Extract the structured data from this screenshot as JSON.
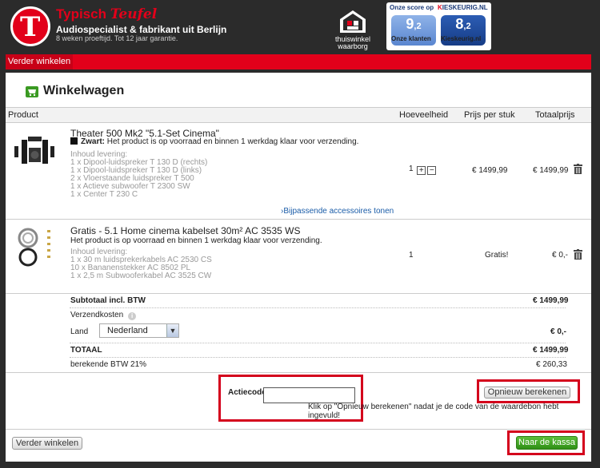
{
  "header": {
    "brand_name": "Typisch",
    "brand_script": "Teufel",
    "tagline": "Audiospecialist & fabrikant uit Berlijn",
    "subtagline": "8 weken proeftijd. Tot 12 jaar garantie.",
    "trust_badge": [
      "thuiswinkel",
      "waarborg"
    ],
    "score_title": "Onze score op",
    "score_brand_k": "K",
    "score_brand_rest": "IESKEURIG.NL",
    "scores": [
      {
        "value": "9",
        "decimal": ",2",
        "label": "Onze klanten"
      },
      {
        "value": "8",
        "decimal": ",2",
        "label": "Kieskeurig.nl"
      }
    ]
  },
  "nav": {
    "continue_shopping": "Verder winkelen"
  },
  "page_title": "Winkelwagen",
  "table": {
    "headers": {
      "product": "Product",
      "quantity": "Hoeveelheid",
      "unit_price": "Prijs per stuk",
      "total": "Totaalprijs"
    },
    "items": [
      {
        "title": "Theater 500 Mk2 \"5.1-Set Cinema\"",
        "color_label": "Zwart:",
        "stock": "Het product is op voorraad en binnen 1 werkdag klaar voor verzending.",
        "contents_label": "Inhoud levering:",
        "contents": [
          "1 x Dipool-luidspreker T 130 D (rechts)",
          "1 x Dipool-luidspreker T 130 D (links)",
          "2 x Vloerstaande luidspreker T 500",
          "1 x Actieve subwoofer T 2300 SW",
          "1 x Center T 230 C"
        ],
        "accessories": "Bijpassende accessoires tonen",
        "quantity": "1",
        "qty_plus": "+",
        "qty_minus": "−",
        "unit_price": "€ 1499,99",
        "total": "€ 1499,99"
      },
      {
        "title": "Gratis - 5.1 Home cinema kabelset 30m² AC 3535 WS",
        "stock": "Het product is op voorraad en binnen 1 werkdag klaar voor verzending.",
        "contents_label": "Inhoud levering:",
        "contents": [
          "1 x 30 m luidsprekerkabels AC 2530 CS",
          "10 x Bananenstekker AC 8502 PL",
          "1 x 2,5 m Subwooferkabel AC 3525 CW"
        ],
        "quantity": "1",
        "unit_price": "Gratis!",
        "total": "€ 0,-"
      }
    ]
  },
  "summary": {
    "subtotal_label": "Subtotaal incl. BTW",
    "subtotal": "€ 1499,99",
    "shipping_label": "Verzendkosten",
    "country_label": "Land",
    "country_value": "Nederland",
    "shipping": "€ 0,-",
    "total_label": "TOTAAL",
    "total": "€ 1499,99",
    "vat_label": "berekende BTW 21%",
    "vat": "€ 260,33"
  },
  "promo": {
    "label": "Actiecode",
    "value": "",
    "recalc_button": "Opnieuw berekenen",
    "hint": "Klik op \"Opnieuw berekenen\" nadat je de code van de waardebon hebt ingevuld!"
  },
  "footer": {
    "continue_button": "Verder winkelen",
    "checkout_button": "Naar de kassa"
  },
  "colors": {
    "brand_red": "#e2001a",
    "checkout_green": "#3fa51f",
    "link_blue": "#1a5ca8"
  }
}
